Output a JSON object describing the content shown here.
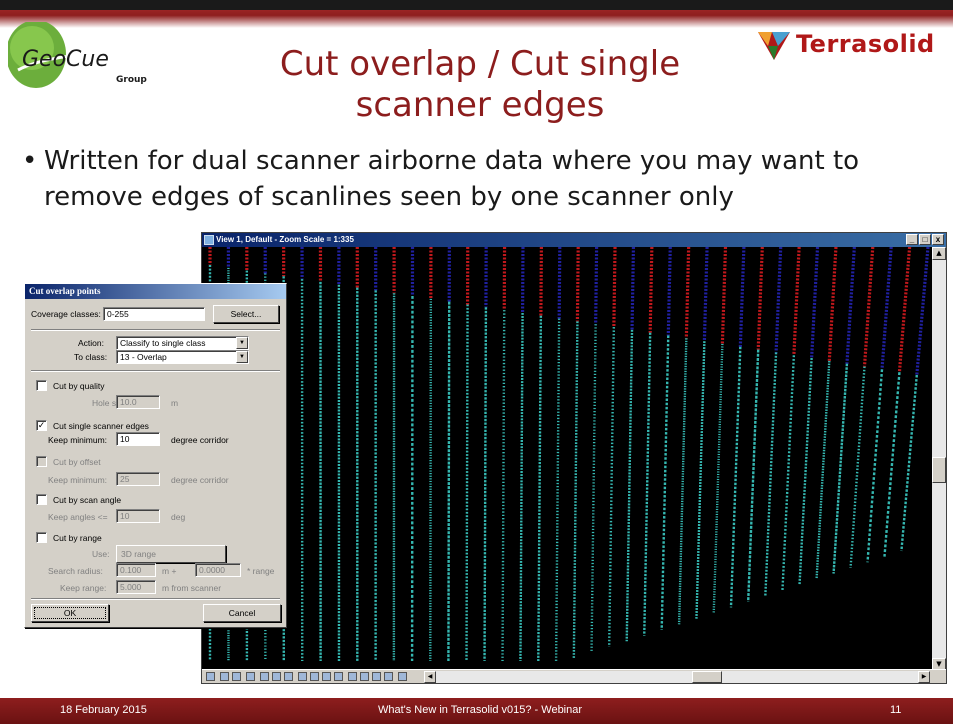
{
  "header": {
    "logo_left": "GeoCue Group",
    "logo_right": "Terrasolid",
    "title_line1": "Cut overlap / Cut single",
    "title_line2": "scanner edges"
  },
  "body": {
    "bullet_symbol": "•",
    "bullet_line1": "Written for dual scanner airborne data where you may want to",
    "bullet_line2": "remove edges of scanlines seen by one scanner only"
  },
  "view_window": {
    "title": "View 1, Default - Zoom Scale = 1:335",
    "btn_min": "_",
    "btn_max": "□",
    "btn_close": "x"
  },
  "dialog": {
    "title": "Cut overlap points",
    "coverage_label": "Coverage classes:",
    "coverage_value": "0-255",
    "select_label": "Select...",
    "action_label": "Action:",
    "action_value": "Classify to single class",
    "to_class_label": "To class:",
    "to_class_value": "13 - Overlap",
    "cut_by_quality_label": "Cut by quality",
    "cut_by_quality_checked": false,
    "hole_size_label": "Hole size:",
    "hole_size_value": "10.0",
    "hole_size_unit": "m",
    "cut_single_label": "Cut single scanner edges",
    "cut_single_checked": true,
    "cut_single_check_glyph": "✓",
    "keep_min_label": "Keep minimum:",
    "keep_min_value": "10",
    "keep_min_unit": "degree corridor",
    "cut_by_offset_label": "Cut by offset",
    "cut_by_offset_checked": false,
    "keep_min2_label": "Keep minimum:",
    "keep_min2_value": "25",
    "keep_min2_unit": "degree corridor",
    "cut_by_scan_angle_label": "Cut by scan angle",
    "cut_by_scan_angle_checked": false,
    "keep_angles_label": "Keep angles <=",
    "keep_angles_value": "10",
    "keep_angles_unit": "deg",
    "cut_by_range_label": "Cut by range",
    "cut_by_range_checked": false,
    "use_label": "Use:",
    "use_value": "3D range",
    "search_radius_label": "Search radius:",
    "search_radius_value": "0.100",
    "search_radius_unit": "m  +",
    "search_radius_factor": "0.0000",
    "search_radius_factor_unit": "* range",
    "keep_range_label": "Keep range:",
    "keep_range_value": "5.000",
    "keep_range_unit": "m   from scanner",
    "ok_label": "OK",
    "cancel_label": "Cancel"
  },
  "footer": {
    "date": "18 February 2015",
    "center": "What's New in Terrasolid v015? - Webinar",
    "slide_number": "11"
  },
  "colors": {
    "brand_red": "#8c1d1d",
    "cyan_points": "#3fd8d0",
    "red_points": "#c0181c",
    "blue_points": "#2020a0"
  }
}
